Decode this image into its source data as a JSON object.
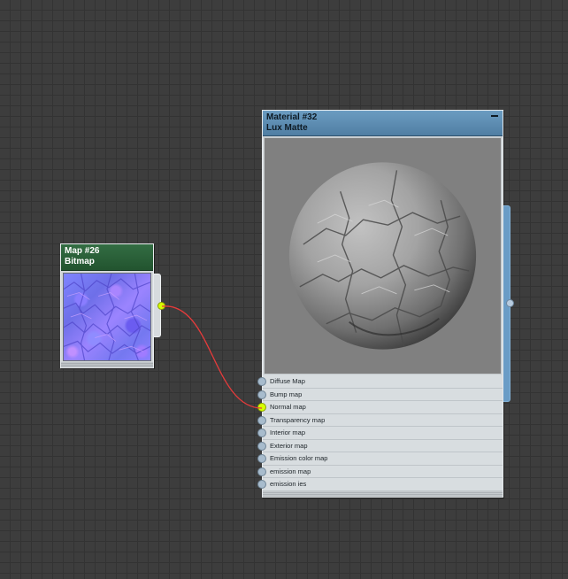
{
  "map_node": {
    "title": "Map #26",
    "type": "Bitmap",
    "header_color": "#2a5e37",
    "thumbnail": "normal-map-texture"
  },
  "material_node": {
    "title": "Material #32",
    "type": "Lux Matte",
    "header_color": "#5e8db2",
    "preview": "rock-sphere-preview",
    "params": [
      {
        "label": "Diffuse Map",
        "linked": false
      },
      {
        "label": "Bump map",
        "linked": false
      },
      {
        "label": "Normal map",
        "linked": true
      },
      {
        "label": "Transparency map",
        "linked": false
      },
      {
        "label": "Interior map",
        "linked": false
      },
      {
        "label": "Exterior map",
        "linked": false
      },
      {
        "label": "Emission color map",
        "linked": false
      },
      {
        "label": "emission map",
        "linked": false
      },
      {
        "label": "emission ies",
        "linked": false
      }
    ]
  },
  "connection": {
    "from": "Map #26",
    "to": "Normal map",
    "wire_color": "#e63b3b",
    "socket_active_color": "#d8ff00"
  }
}
